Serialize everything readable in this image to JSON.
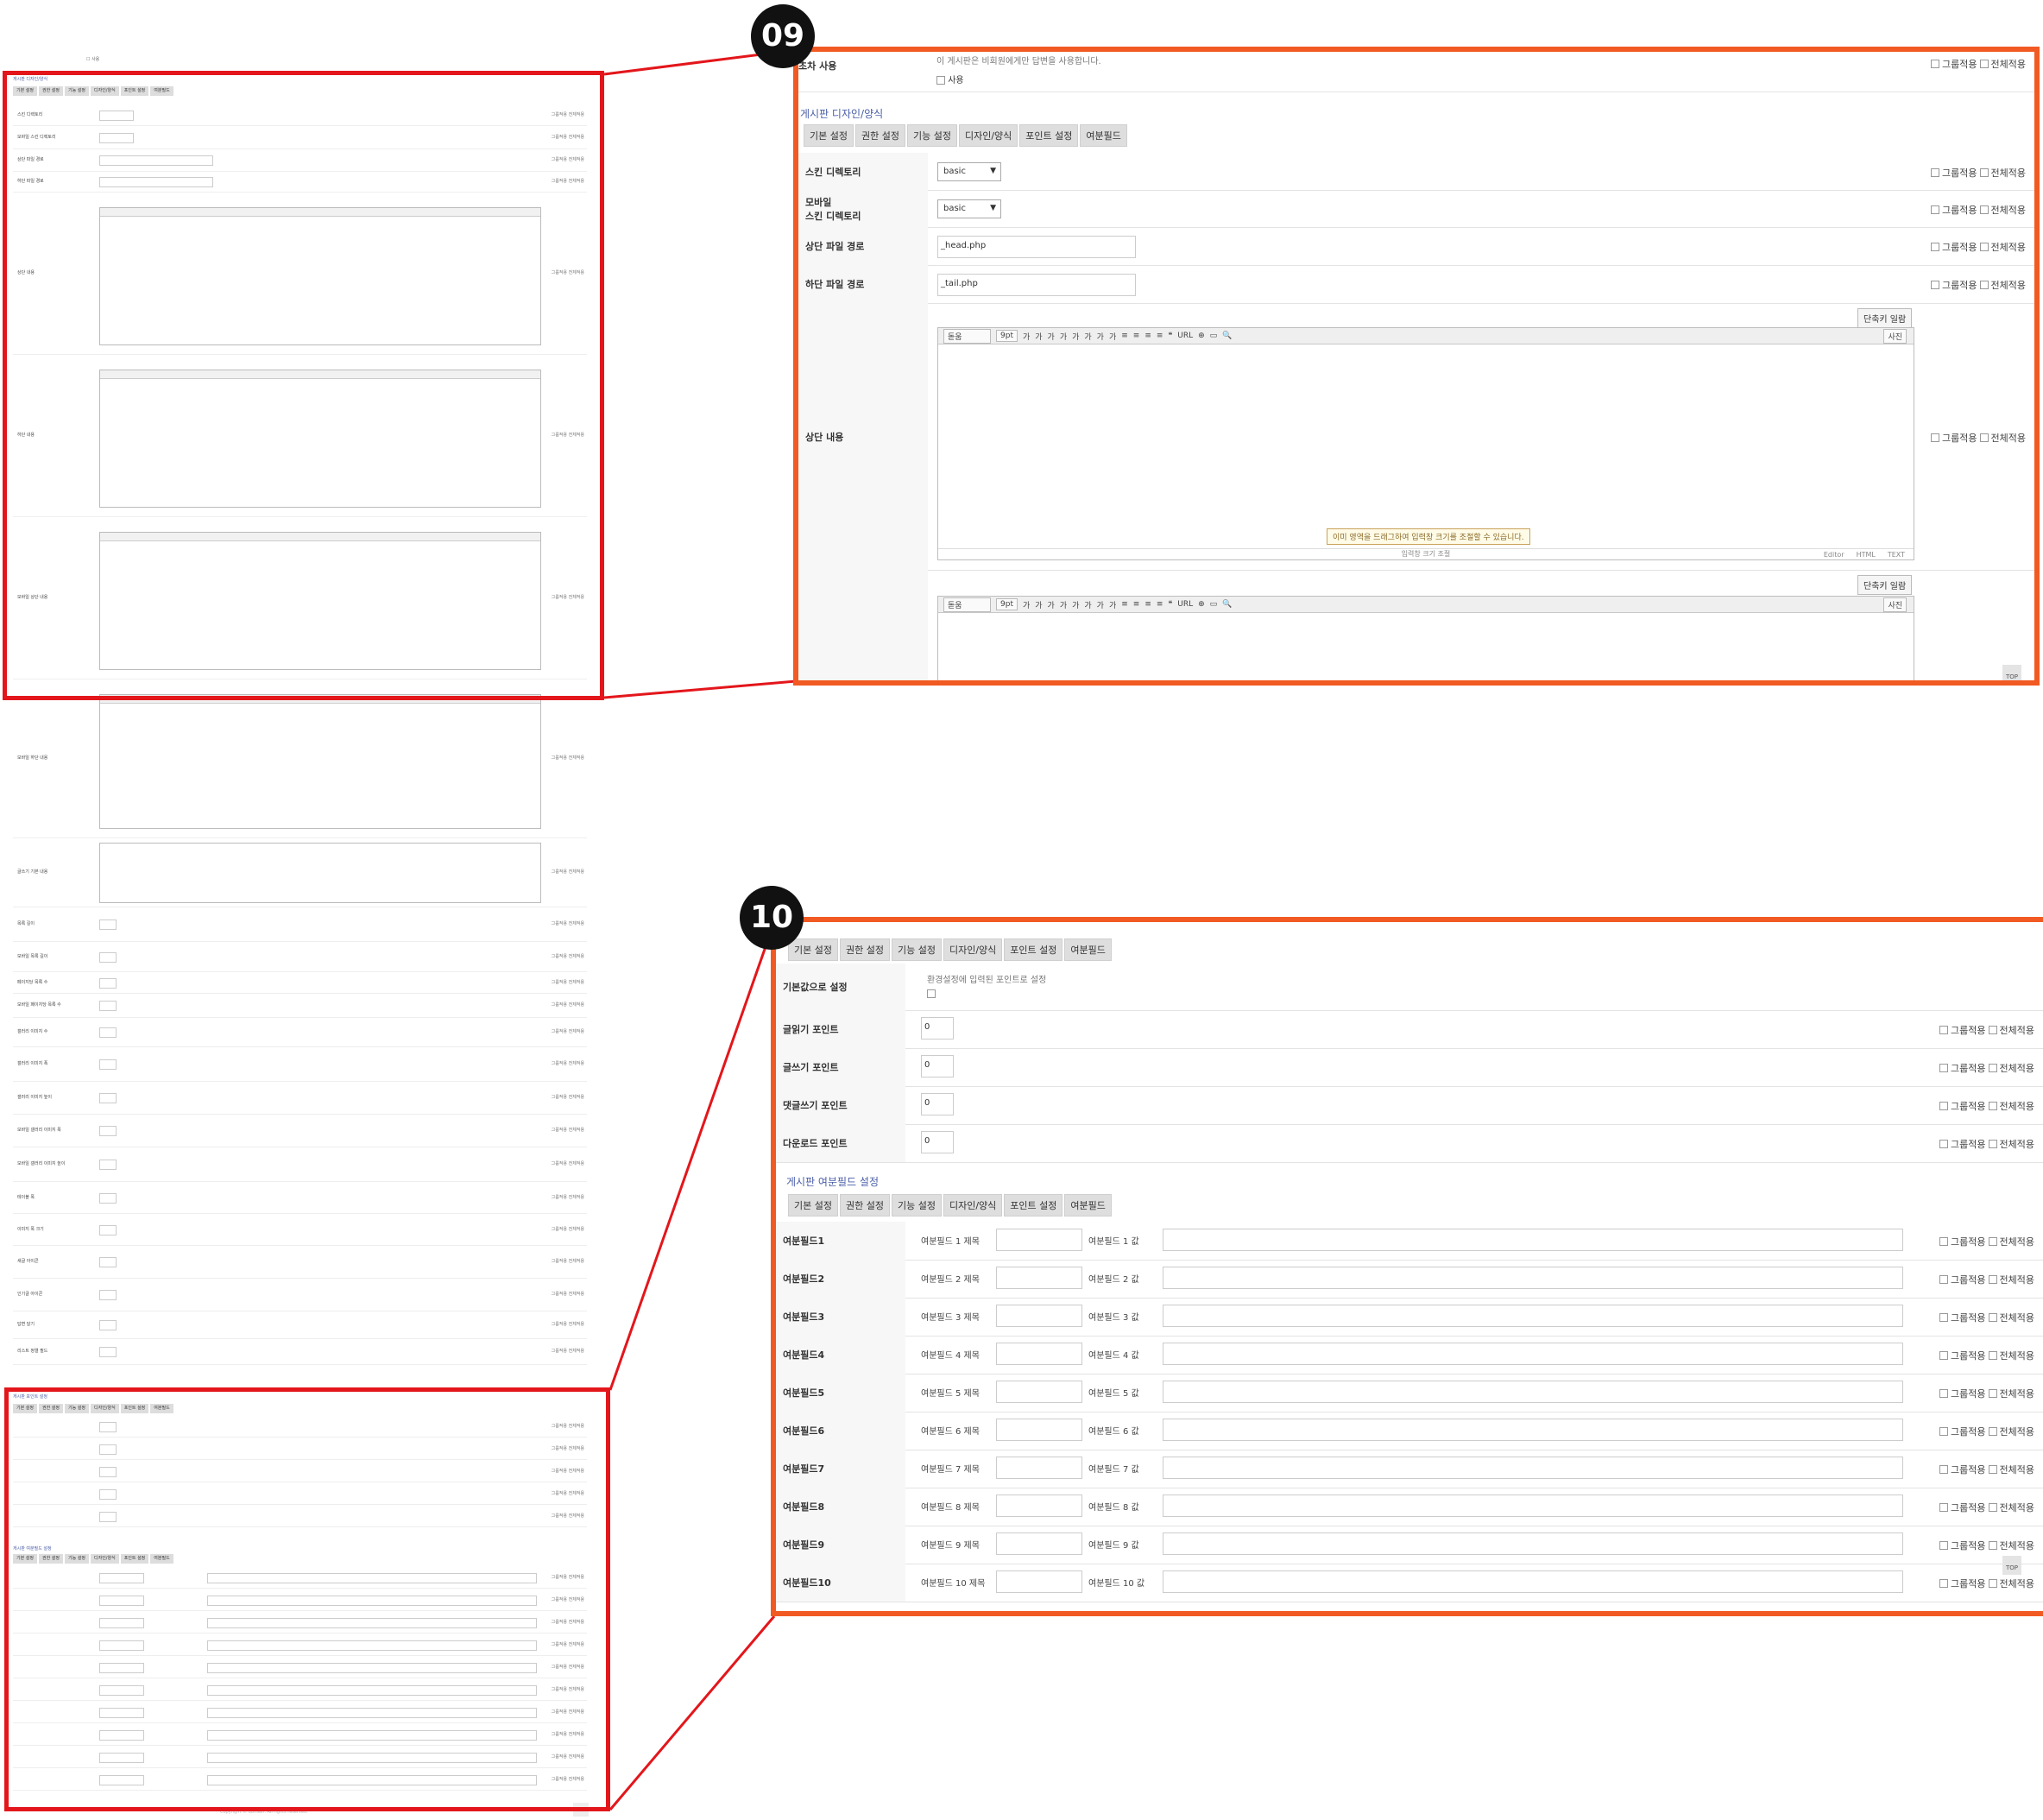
{
  "callout1": {
    "badge": "09",
    "prev_row_label": "초차 사용",
    "prev_row_note": "이 게시판은 비회원에게만 답변을 사용합니다.",
    "prev_row_checkbox": "사용",
    "section_title": "게시판 디자인/양식",
    "tabs": [
      "기본 설정",
      "권한 설정",
      "기능 설정",
      "디자인/양식",
      "포인트 설정",
      "여분필드"
    ],
    "group_apply": "그룹적용",
    "all_apply": "전체적용",
    "rows": [
      {
        "label": "스킨 디렉토리",
        "value": "basic"
      },
      {
        "label": "모바일\n스킨 디렉토리",
        "value": "basic"
      },
      {
        "label": "상단 파일 경로",
        "value": "_head.php"
      },
      {
        "label": "하단 파일 경로",
        "value": "_tail.php"
      },
      {
        "label": "상단 내용",
        "value": ""
      }
    ],
    "shortcut_button": "단축키 일람",
    "editor_font": "돋움",
    "editor_size": "9pt",
    "editor_tools": [
      "가",
      "가",
      "가",
      "가",
      "가",
      "가",
      "가",
      "가",
      "≡",
      "≡",
      "≡",
      "≡",
      "❝",
      "URL",
      "⊕",
      "▭",
      "🔍"
    ],
    "editor_photo": "사진",
    "editor_hint": "이미 영역을 드래그하여 입력창 크기를 조절할 수 있습니다.",
    "editor_footer": "입력창 크기 조절",
    "editor_modes": [
      "Editor",
      "HTML",
      "TEXT"
    ],
    "top_label": "TOP"
  },
  "callout2": {
    "badge": "10",
    "tabs": [
      "기본 설정",
      "권한 설정",
      "기능 설정",
      "디자인/양식",
      "포인트 설정",
      "여분필드"
    ],
    "default_row": {
      "label": "기본값으로 설정",
      "note": "환경설정에 입력된 포인트로 설정"
    },
    "point_rows": [
      {
        "label": "글읽기 포인트",
        "value": "0"
      },
      {
        "label": "글쓰기 포인트",
        "value": "0"
      },
      {
        "label": "댓글쓰기 포인트",
        "value": "0"
      },
      {
        "label": "다운로드 포인트",
        "value": "0"
      }
    ],
    "extra_section_title": "게시판 여분필드 설정",
    "extra_rows": [
      {
        "label": "여분필드1",
        "title": "여분필드 1 제목",
        "value": "여분필드 1 값"
      },
      {
        "label": "여분필드2",
        "title": "여분필드 2 제목",
        "value": "여분필드 2 값"
      },
      {
        "label": "여분필드3",
        "title": "여분필드 3 제목",
        "value": "여분필드 3 값"
      },
      {
        "label": "여분필드4",
        "title": "여분필드 4 제목",
        "value": "여분필드 4 값"
      },
      {
        "label": "여분필드5",
        "title": "여분필드 5 제목",
        "value": "여분필드 5 값"
      },
      {
        "label": "여분필드6",
        "title": "여분필드 6 제목",
        "value": "여분필드 6 값"
      },
      {
        "label": "여분필드7",
        "title": "여분필드 7 제목",
        "value": "여분필드 7 값"
      },
      {
        "label": "여분필드8",
        "title": "여분필드 8 제목",
        "value": "여분필드 8 값"
      },
      {
        "label": "여분필드9",
        "title": "여분필드 9 제목",
        "value": "여분필드 9 값"
      },
      {
        "label": "여분필드10",
        "title": "여분필드 10 제목",
        "value": "여분필드 10 값"
      }
    ],
    "group_apply": "그룹적용",
    "all_apply": "전체적용",
    "top_label": "TOP"
  },
  "overview": {
    "section1": "게시판 디자인/양식",
    "tabs": [
      "기본 설정",
      "권한 설정",
      "기능 설정",
      "디자인/양식",
      "포인트 설정",
      "여분필드"
    ],
    "labels": [
      "스킨 디렉토리",
      "모바일 스킨 디렉토리",
      "상단 파일 경로",
      "하단 파일 경로",
      "상단 내용",
      "하단 내용",
      "모바일 상단 내용",
      "모바일 하단 내용",
      "글쓰기 기본 내용",
      "목록 길이",
      "모바일 목록 길이",
      "페이지당 목록 수",
      "모바일 페이지당 목록 수",
      "갤러리 이미지 수",
      "갤러리 이미지 폭",
      "갤러리 이미지 높이",
      "모바일 갤러리 이미지 폭",
      "모바일 갤러리 이미지 높이",
      "테이블 폭",
      "이미지 폭 크기",
      "새글 아이콘",
      "인기글 아이콘",
      "답변 달기",
      "리스트 정렬 필드"
    ],
    "section2": "게시판 포인트 설정",
    "section3": "게시판 여분필드 설정",
    "apply_text": "그룹적용 전체적용",
    "copyright": "Copyright © domain. All rights reserved."
  }
}
